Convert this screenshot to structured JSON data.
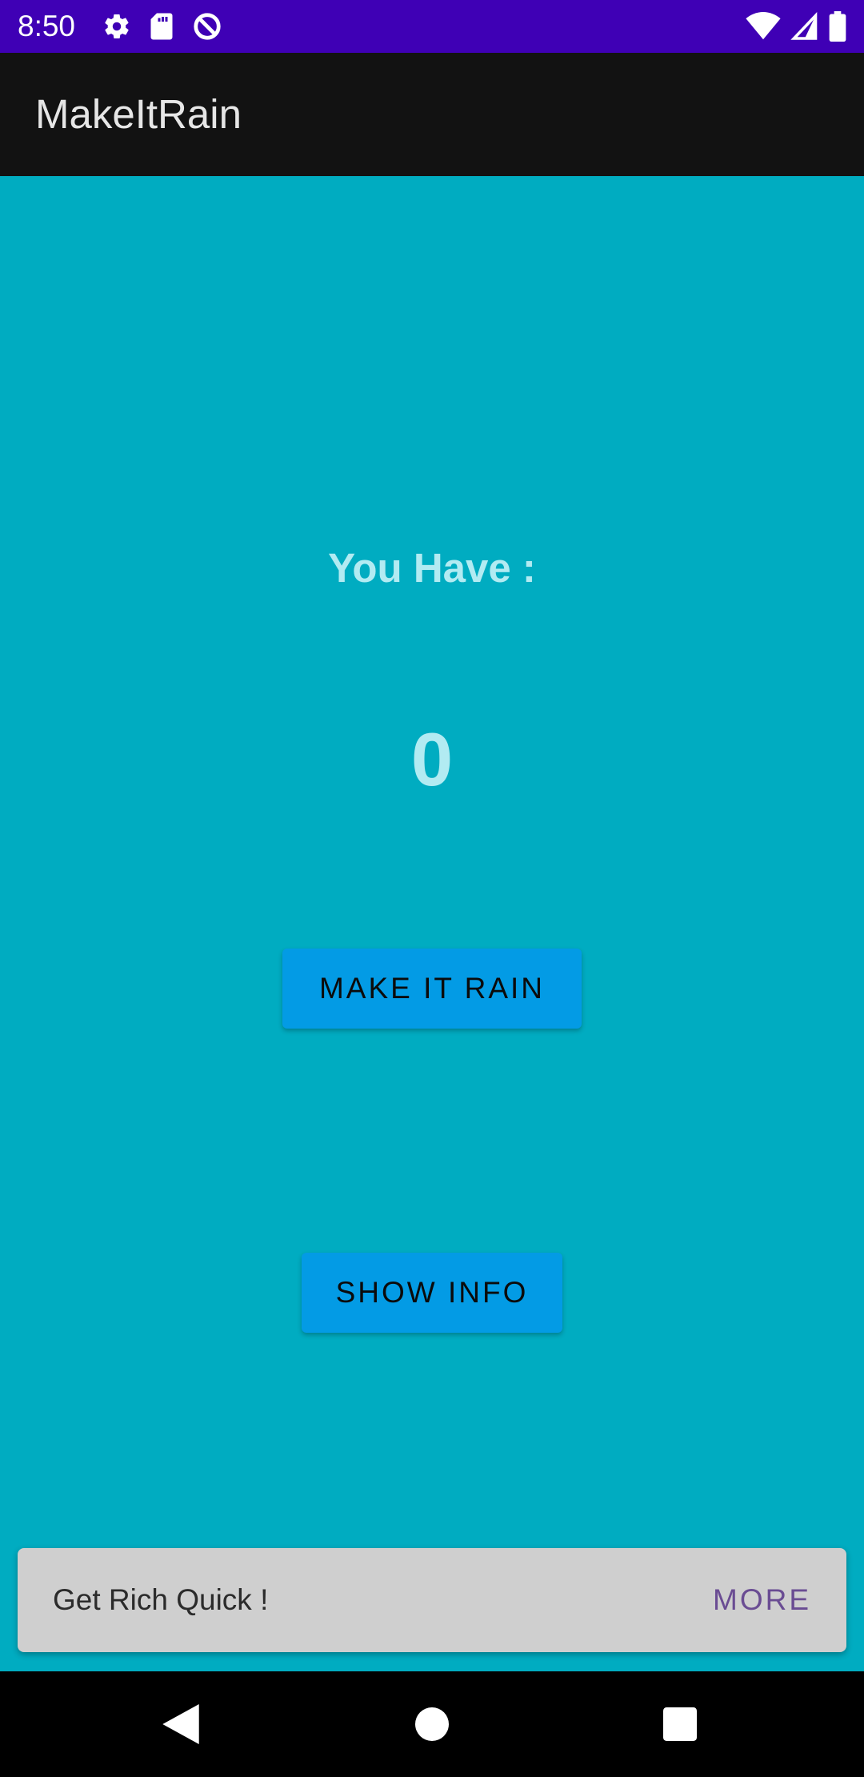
{
  "status_bar": {
    "time": "8:50",
    "left_icons": [
      "settings-icon",
      "sd-card-icon",
      "data-saver-icon"
    ],
    "right_icons": [
      "wifi-icon",
      "cell-signal-icon",
      "battery-icon"
    ],
    "background_color": "#3F00B5"
  },
  "app_bar": {
    "title": "MakeItRain",
    "background_color": "#121212"
  },
  "main": {
    "background_color": "#00ACC1",
    "label": "You Have :",
    "amount": "0",
    "make_it_rain_button": "MAKE IT RAIN",
    "show_info_button": "SHOW INFO",
    "button_color": "#039BE5",
    "text_color": "#B2EBF2"
  },
  "snackbar": {
    "message": "Get Rich Quick !",
    "action": "MORE",
    "action_color": "#6A4C93"
  },
  "nav_bar": {
    "icons": [
      "back-icon",
      "home-icon",
      "recents-icon"
    ]
  }
}
